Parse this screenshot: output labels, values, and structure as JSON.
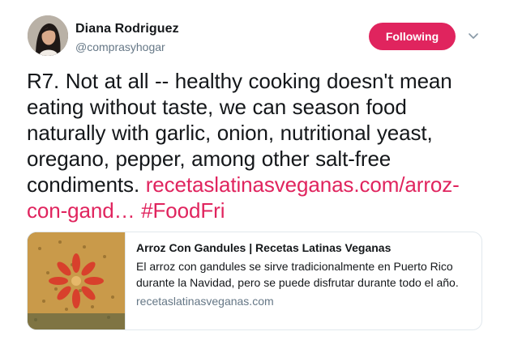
{
  "author": {
    "display_name": "Diana Rodriguez",
    "handle": "@comprasyhogar"
  },
  "follow_button": {
    "label": "Following",
    "color": "#e0245e"
  },
  "tweet": {
    "text": "R7. Not at all -- healthy cooking doesn't mean eating without taste, we can season food naturally with garlic, onion, nutritional yeast, oregano, pepper, among other salt-free condiments.",
    "link_text": "recetaslatinasveganas.com/arroz-con-gand…",
    "hashtag": "#FoodFri",
    "link_color": "#e0245e"
  },
  "card": {
    "title": "Arroz Con Gandules | Recetas Latinas Veganas",
    "description": "El arroz con gandules se sirve tradicionalmente en Puerto Rico durante la Navidad, pero se puede disfrutar durante todo el año.",
    "domain": "recetaslatinasveganas.com"
  }
}
